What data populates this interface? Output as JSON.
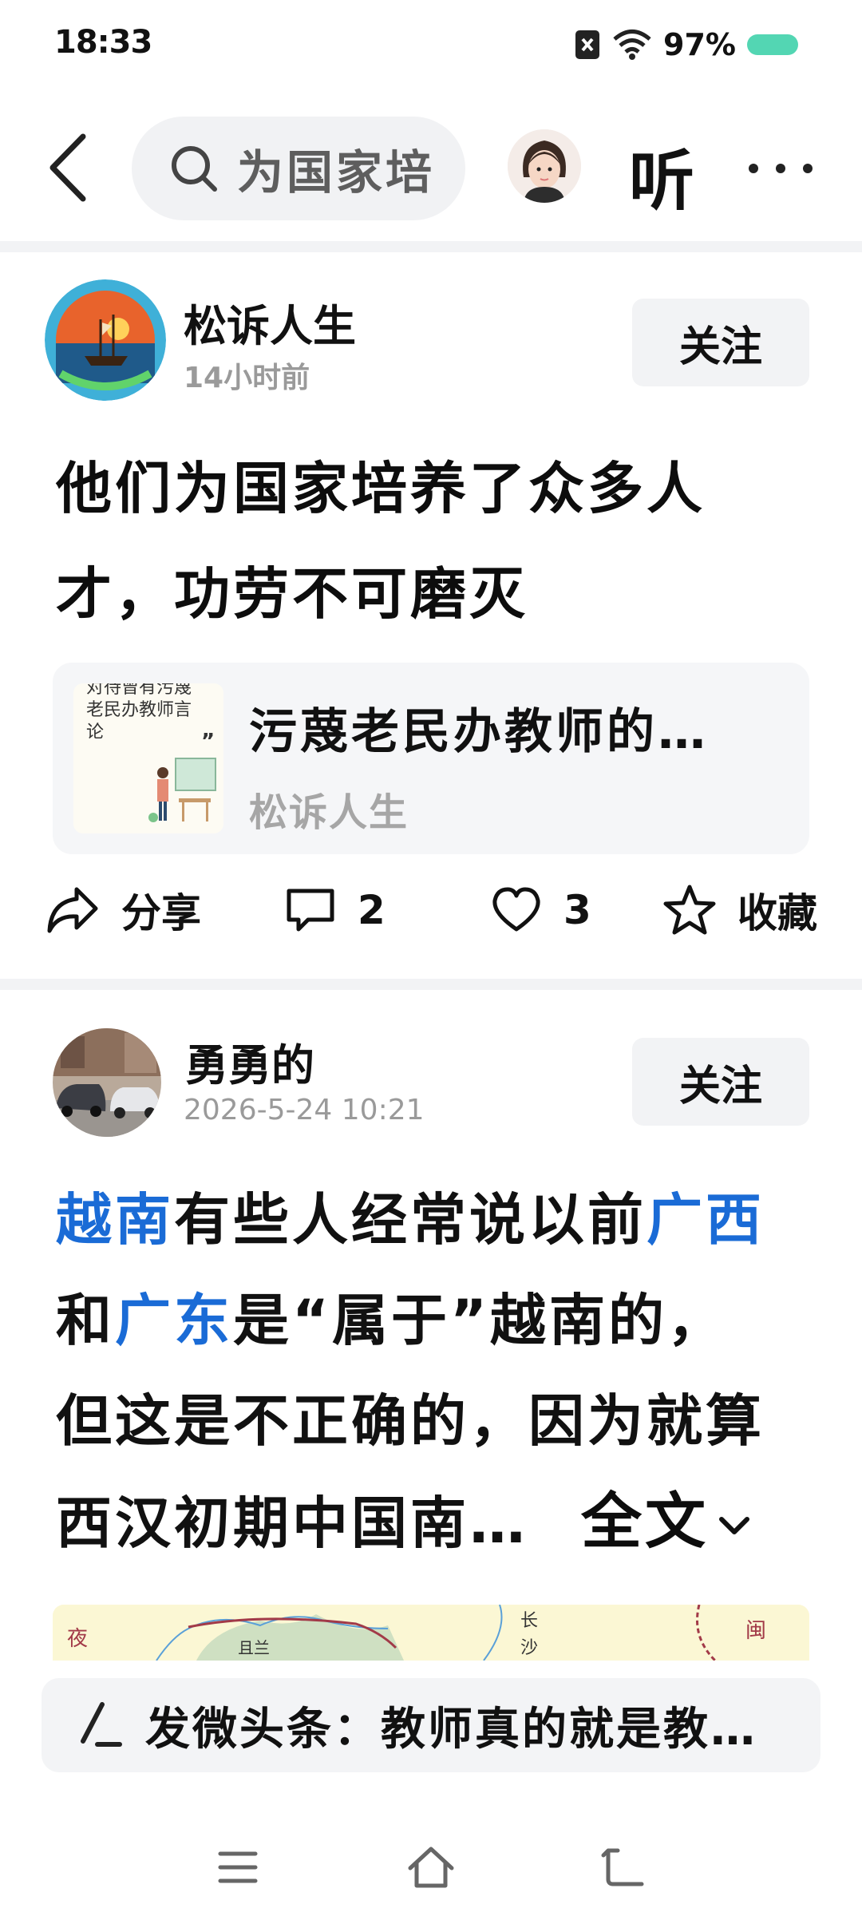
{
  "status": {
    "time": "18:33",
    "battery": "97%"
  },
  "nav": {
    "search_text": "为国家培",
    "listen": "听"
  },
  "post1": {
    "author": "松诉人生",
    "time": "14小时前",
    "follow": "关注",
    "title_line1": "他们为国家培养了众多人",
    "title_line2": "才，功劳不可磨灭",
    "link": {
      "thumb_text_top": "对待曾有污蔑",
      "thumb_text_line1": "老民办教师言",
      "thumb_text_line2": "论",
      "title": "污蔑老民办教师的…",
      "source": "松诉人生"
    },
    "actions": {
      "share": "分享",
      "comments": "2",
      "likes": "3",
      "favorite": "收藏"
    }
  },
  "post2": {
    "author": "勇勇的",
    "time": "2026-5-24 10:21",
    "follow": "关注",
    "text": {
      "l1_link1": "越南",
      "l1_mid": "有些人经常说以前",
      "l1_link2": "广西",
      "l2_pre": "和",
      "l2_link": "广东",
      "l2_post": "是“属于”越南的，",
      "l3": "但这是不正确的，因为就算",
      "l4": "西汉初期中国南…"
    },
    "expand": "全文",
    "map_labels": {
      "a": "夜",
      "b": "且兰",
      "c": "长",
      "d": "沙",
      "e": "闽"
    }
  },
  "compose": {
    "text": "发微头条：教师真的就是教…"
  }
}
